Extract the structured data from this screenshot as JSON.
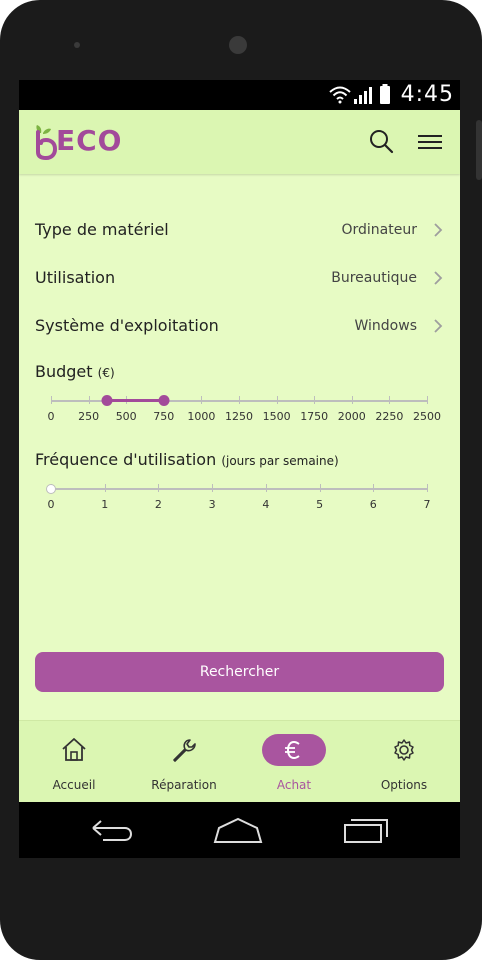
{
  "status_bar": {
    "time": "4:45"
  },
  "app": {
    "logo_text": "ECO"
  },
  "header": {
    "icons": [
      "search-icon",
      "menu-icon"
    ]
  },
  "filters": [
    {
      "label": "Type de matériel",
      "value": "Ordinateur"
    },
    {
      "label": "Utilisation",
      "value": "Bureautique"
    },
    {
      "label": "Système d'exploitation",
      "value": "Windows"
    }
  ],
  "budget": {
    "label": "Budget",
    "unit": "(€)",
    "ticks": [
      "0",
      "250",
      "500",
      "750",
      "1000",
      "1250",
      "1500",
      "1750",
      "2000",
      "2250",
      "2500"
    ],
    "min": 0,
    "max": 2500,
    "range_low": 375,
    "range_high": 750
  },
  "frequency": {
    "label": "Fréquence d'utilisation",
    "unit": "(jours par semaine)",
    "ticks": [
      "0",
      "1",
      "2",
      "3",
      "4",
      "5",
      "6",
      "7"
    ],
    "min": 0,
    "max": 7,
    "value": 0
  },
  "search_button": {
    "label": "Rechercher"
  },
  "bottom_nav": [
    {
      "label": "Accueil",
      "icon": "home-icon",
      "active": false
    },
    {
      "label": "Réparation",
      "icon": "wrench-icon",
      "active": false
    },
    {
      "label": "Achat",
      "icon": "euro-icon",
      "active": true
    },
    {
      "label": "Options",
      "icon": "gear-icon",
      "active": false
    }
  ],
  "colors": {
    "accent": "#a9559f",
    "background": "#e7fbc4",
    "appbar": "#dbf6b2",
    "logo_leaf": "#7cb342"
  }
}
